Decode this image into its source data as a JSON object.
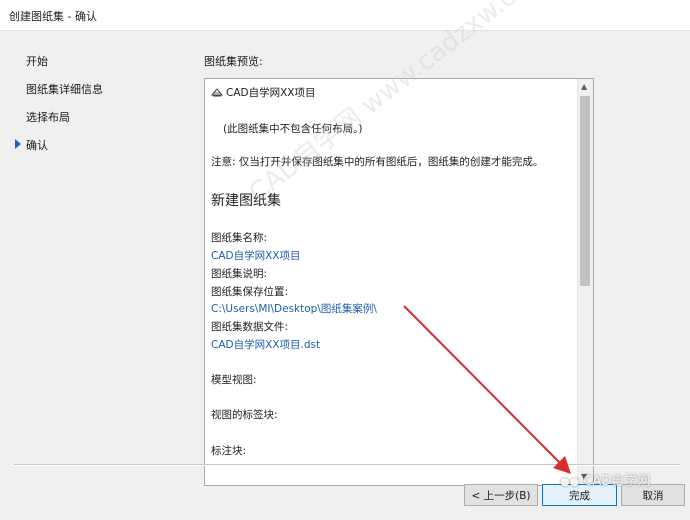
{
  "window": {
    "title": "创建图纸集 - 确认"
  },
  "nav": {
    "items": [
      {
        "label": "开始"
      },
      {
        "label": "图纸集详细信息"
      },
      {
        "label": "选择布局"
      },
      {
        "label": "确认"
      }
    ],
    "active_index": 3
  },
  "preview": {
    "label": "图纸集预览:",
    "sheet_set_name": "CAD自学网XX项目",
    "no_layouts_note": "(此图纸集中不包含任何布局。)",
    "warning": "注意: 仅当打开并保存图纸集中的所有图纸后，图纸集的创建才能完成。",
    "heading": "新建图纸集",
    "name_label": "图纸集名称:",
    "name_value": "CAD自学网XX项目",
    "description_label": "图纸集说明:",
    "location_label": "图纸集保存位置:",
    "location_value": "C:\\Users\\MI\\Desktop\\图纸集案例\\",
    "data_file_label": "图纸集数据文件:",
    "data_file_value": "CAD自学网XX项目.dst",
    "model_view_label": "模型视图:",
    "view_label_block_label": "视图的标签块:",
    "callout_block_label": "标注块:"
  },
  "buttons": {
    "back": "< 上一步(B)",
    "finish": "完成",
    "cancel": "取消"
  },
  "watermarks": {
    "diagonal": "CAD自学网 www.cadzxw.com",
    "brand": "CAD自学网"
  },
  "colors": {
    "accent": "#1e64c8",
    "link": "#1f5fb0",
    "arrow": "#d62e2e"
  }
}
